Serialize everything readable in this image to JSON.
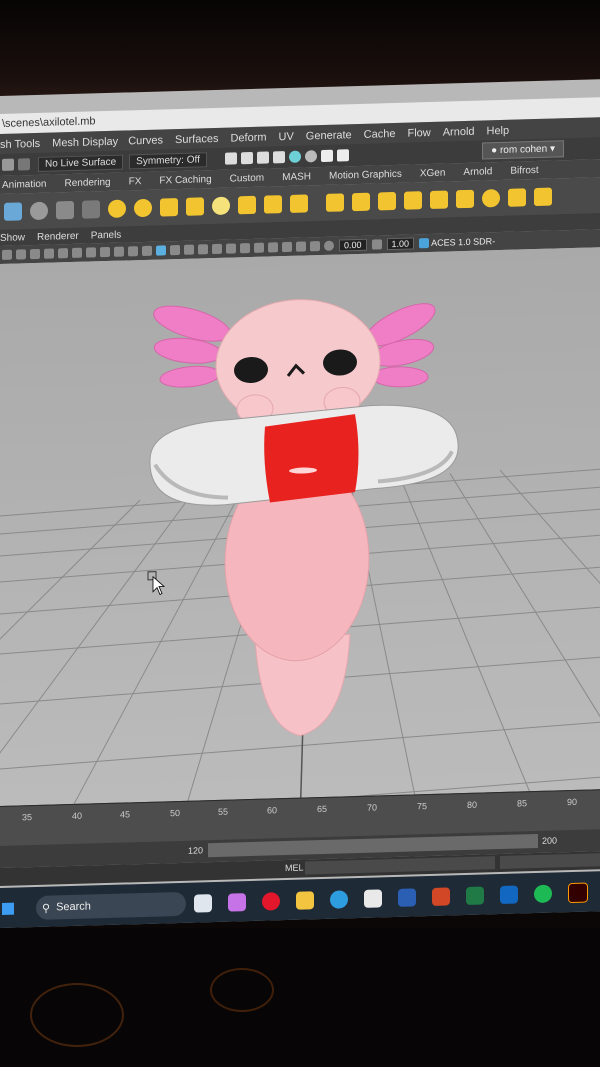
{
  "window": {
    "title": "\\scenes\\axilotel.mb"
  },
  "menubar": {
    "items": [
      "sh Tools",
      "Mesh Display",
      "Curves",
      "Surfaces",
      "Deform",
      "UV",
      "Generate",
      "Cache",
      "Flow",
      "Arnold",
      "Help"
    ]
  },
  "status": {
    "live_surface": "No Live Surface",
    "symmetry": "Symmetry: Off",
    "user": "rom cohen"
  },
  "shelf_tabs": [
    "Animation",
    "Rendering",
    "FX",
    "FX Caching",
    "Custom",
    "MASH",
    "Motion Graphics",
    "XGen",
    "Arnold",
    "Bifrost"
  ],
  "panel_menu": [
    "Show",
    "Renderer",
    "Panels"
  ],
  "panel_fields": {
    "exposure": "0.00",
    "gamma": "1.00",
    "color_space": "ACES 1.0 SDR-"
  },
  "viewport": {
    "camera": "persp"
  },
  "timeline": {
    "ticks": [
      "35",
      "40",
      "45",
      "50",
      "55",
      "60",
      "65",
      "70",
      "75",
      "80",
      "85",
      "90"
    ]
  },
  "range": {
    "current": "120",
    "end": "200"
  },
  "command_line": {
    "label": "MEL"
  },
  "taskbar": {
    "search_label": "Search"
  },
  "colors": {
    "axolotl_body": "#f4b6bd",
    "gills": "#f07dc4",
    "float_red": "#e8221f",
    "float_white": "#eeeeee",
    "viewport_bg": "#b5b5b5"
  }
}
